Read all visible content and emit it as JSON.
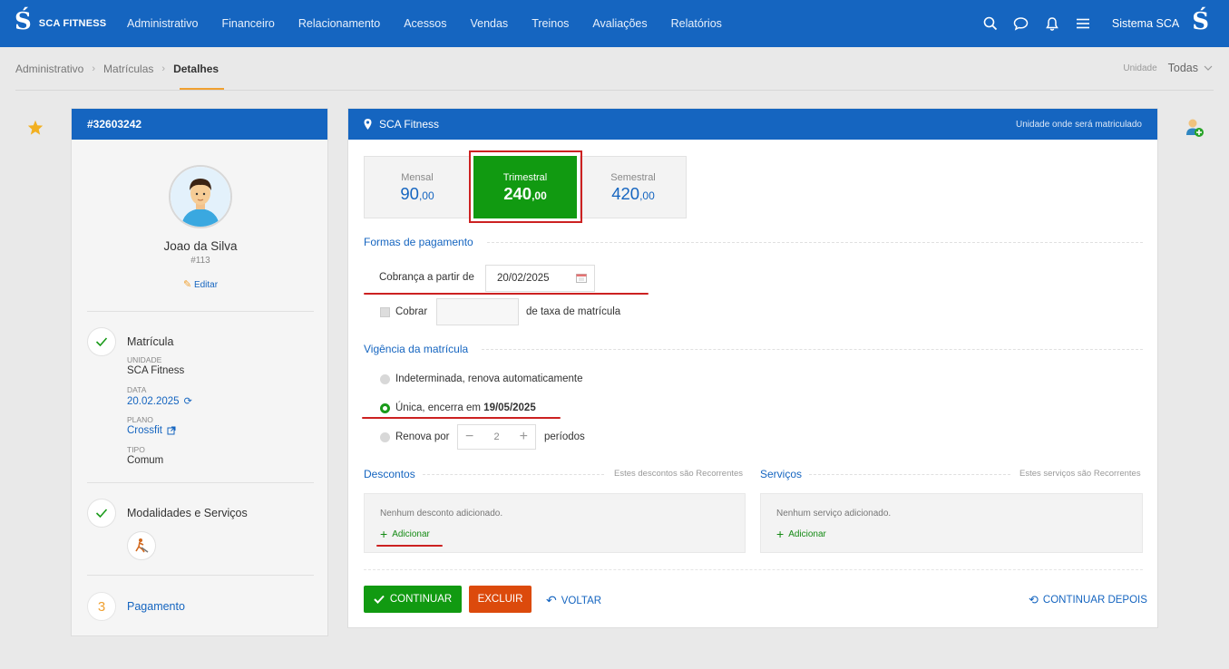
{
  "brand": {
    "name": "SCA FITNESS",
    "logo_glyph": "Ś"
  },
  "nav": [
    "Administrativo",
    "Financeiro",
    "Relacionamento",
    "Acessos",
    "Vendas",
    "Treinos",
    "Avaliações",
    "Relatórios"
  ],
  "topbar": {
    "system_name": "Sistema SCA",
    "icons": [
      "search-icon",
      "chat-icon",
      "bell-icon",
      "menu-icon"
    ]
  },
  "breadcrumb": [
    "Administrativo",
    "Matrículas",
    "Detalhes"
  ],
  "unit_selector": {
    "label": "Unidade",
    "value": "Todas"
  },
  "member": {
    "header": "#32603242",
    "name": "Joao da Silva",
    "number": "#113",
    "edit_label": "Editar"
  },
  "steps": {
    "matricula": {
      "title": "Matrícula",
      "unidade_label": "UNIDADE",
      "unidade": "SCA Fitness",
      "data_label": "DATA",
      "data": "20.02.2025",
      "plano_label": "PLANO",
      "plano": "Crossfit",
      "tipo_label": "TIPO",
      "tipo": "Comum"
    },
    "modalidades": {
      "title": "Modalidades e Serviços"
    },
    "pagamento": {
      "number": "3",
      "title": "Pagamento"
    }
  },
  "main": {
    "header_title": "SCA Fitness",
    "header_note": "Unidade onde será matriculado",
    "plans": [
      {
        "label": "Mensal",
        "int": "90",
        "dec": ",00",
        "selected": false
      },
      {
        "label": "Trimestral",
        "int": "240",
        "dec": ",00",
        "selected": true
      },
      {
        "label": "Semestral",
        "int": "420",
        "dec": ",00",
        "selected": false
      }
    ],
    "formas_title": "Formas de pagamento",
    "cobranca_label": "Cobrança a partir de",
    "cobranca_date": "20/02/2025",
    "cobrar_label": "Cobrar",
    "taxa_label": "de taxa de matrícula",
    "vigencia_title": "Vigência da matrícula",
    "opt_indeterminada": "Indeterminada, renova automaticamente",
    "opt_unica_prefix": "Única, encerra em",
    "opt_unica_date": "19/05/2025",
    "opt_renova": "Renova por",
    "renova_value": "2",
    "renova_suffix": "períodos",
    "descontos_title": "Descontos",
    "descontos_note": "Estes descontos são Recorrentes",
    "descontos_empty": "Nenhum desconto adicionado.",
    "servicos_title": "Serviços",
    "servicos_note": "Estes serviços são Recorrentes",
    "servicos_empty": "Nenhum serviço adicionado.",
    "add_label": "Adicionar",
    "btn_continuar": "CONTINUAR",
    "btn_excluir": "EXCLUIR",
    "btn_voltar": "VOLTAR",
    "btn_continuar_depois": "CONTINUAR DEPOIS"
  },
  "colors": {
    "primary": "#1565c0",
    "success": "#119a11",
    "danger": "#dc4a0c",
    "highlight": "#cc2121",
    "accent": "#f0a030"
  }
}
